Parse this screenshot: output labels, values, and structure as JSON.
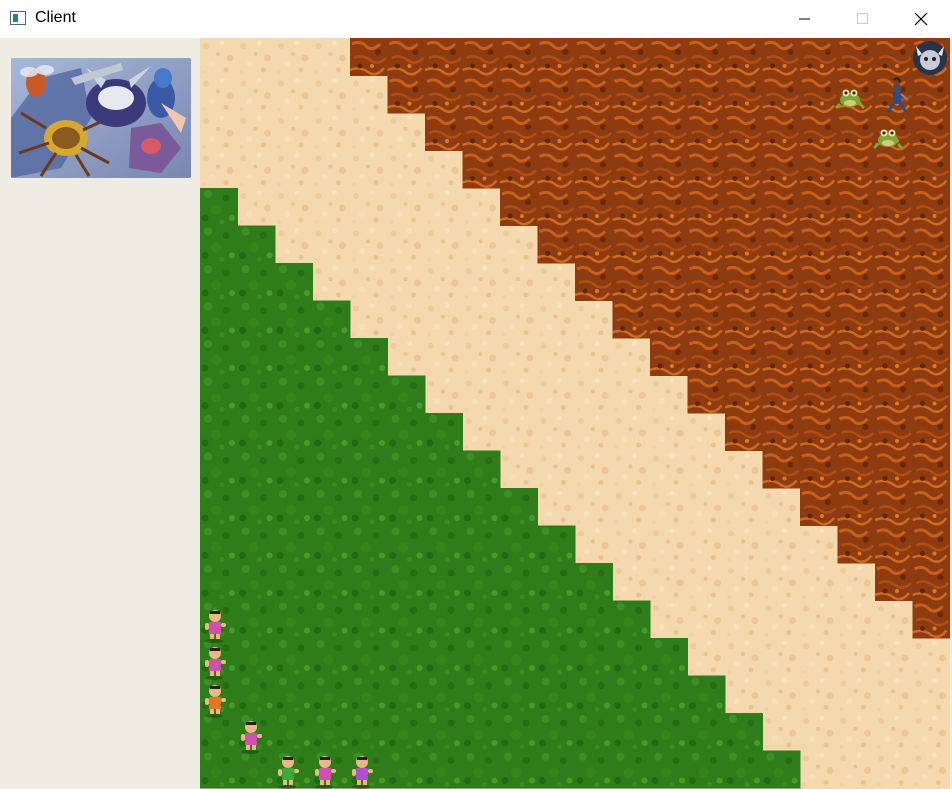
{
  "window": {
    "title": "Client",
    "controls": {
      "minimize": "minimize-icon",
      "maximize": "maximize-icon",
      "close": "close-icon"
    }
  },
  "sidebar": {
    "portrait": "villains-portrait"
  },
  "board": {
    "terrain": {
      "grass_color": "#2f7d1a",
      "sand_color": "#f4d8ae",
      "lava_color": "#8d3b10"
    },
    "units": {
      "heroes": 7,
      "enemies": 4
    }
  }
}
